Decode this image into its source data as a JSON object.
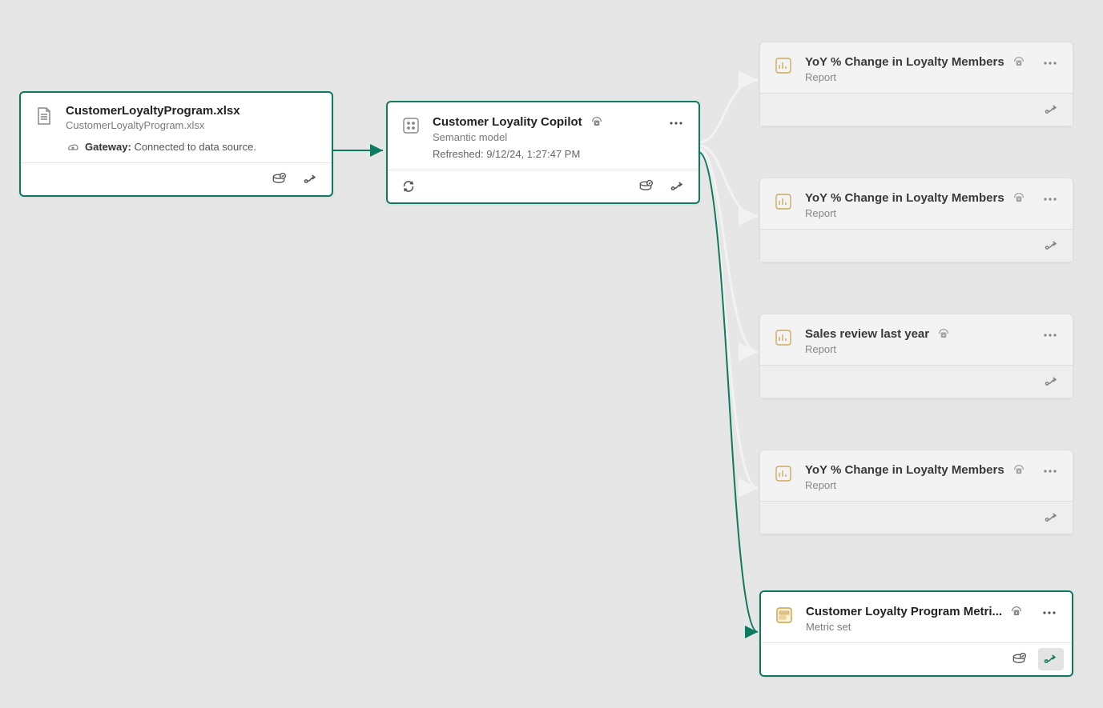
{
  "nodes": {
    "file": {
      "title": "CustomerLoyaltyProgram.xlsx",
      "subtitle": "CustomerLoyaltyProgram.xlsx",
      "gateway_label": "Gateway:",
      "gateway_value": "Connected to data source."
    },
    "model": {
      "title": "Customer Loyality Copilot",
      "subtitle": "Semantic model",
      "refreshed": "Refreshed: 9/12/24, 1:27:47 PM"
    },
    "reports": [
      {
        "title": "YoY % Change in Loyalty Members",
        "subtitle": "Report"
      },
      {
        "title": "YoY % Change in Loyalty Members",
        "subtitle": "Report"
      },
      {
        "title": "Sales review last year",
        "subtitle": "Report"
      },
      {
        "title": "YoY % Change in Loyalty Members",
        "subtitle": "Report"
      }
    ],
    "metric": {
      "title": "Customer Loyalty Program Metri...",
      "subtitle": "Metric set"
    }
  }
}
